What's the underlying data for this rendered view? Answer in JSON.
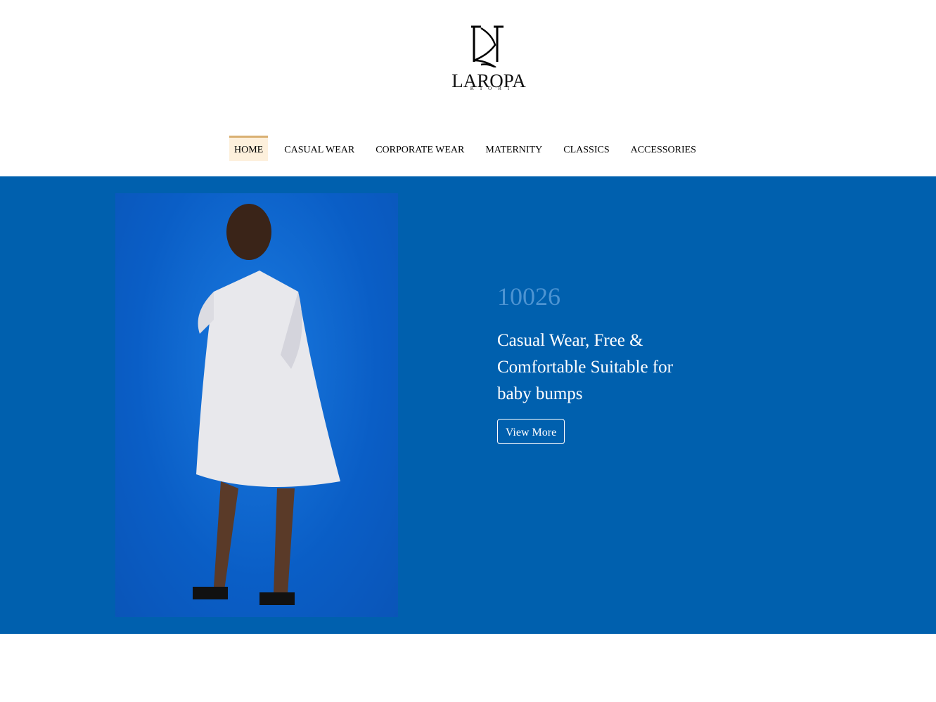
{
  "brand": {
    "logo_text": "LAROPA",
    "logo_subtext": "KIORI"
  },
  "nav": {
    "items": [
      {
        "label": "HOME",
        "active": true
      },
      {
        "label": "CASUAL WEAR"
      },
      {
        "label": "CORPORATE WEAR"
      },
      {
        "label": "MATERNITY"
      },
      {
        "label": "CLASSICS"
      },
      {
        "label": "ACCESSORIES"
      }
    ]
  },
  "hero": {
    "number": "10026",
    "description": "Casual Wear, Free & Comfortable Suitable for baby bumps",
    "button_label": "View More",
    "background_color": "#0060ae",
    "accent_color": "#d9b072"
  }
}
